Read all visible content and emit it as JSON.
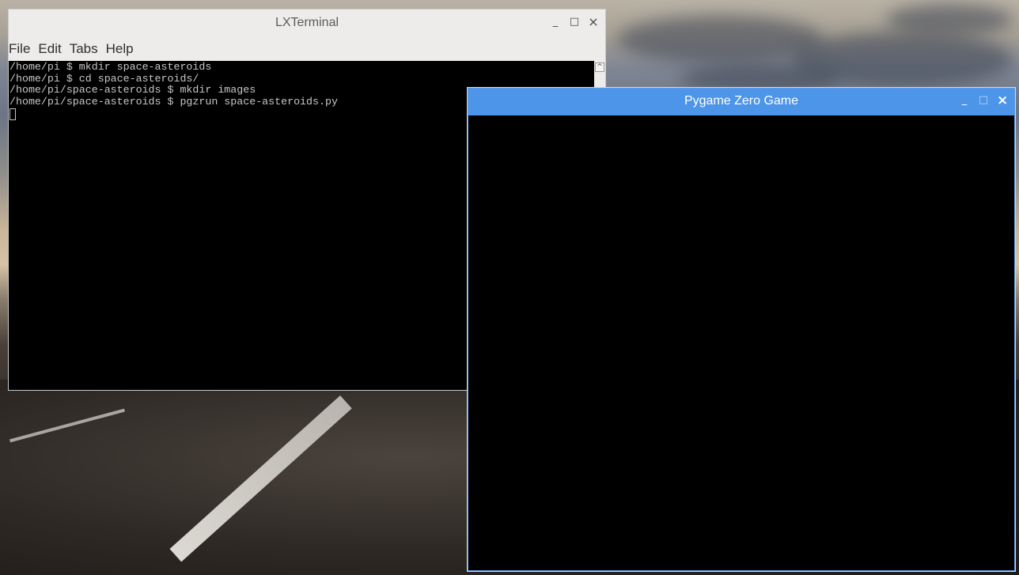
{
  "terminal": {
    "title": "LXTerminal",
    "menu": [
      "File",
      "Edit",
      "Tabs",
      "Help"
    ],
    "lines": [
      "/home/pi $ mkdir space-asteroids",
      "/home/pi $ cd space-asteroids/",
      "/home/pi/space-asteroids $ mkdir images",
      "/home/pi/space-asteroids $ pgzrun space-asteroids.py"
    ],
    "controls": {
      "minimize": "_",
      "maximize": "□",
      "close": "×"
    },
    "scroll_up_glyph": "^"
  },
  "game_window": {
    "title": "Pygame Zero Game",
    "controls": {
      "minimize": "_",
      "maximize": "□",
      "close": "×"
    },
    "background_color": "#000000"
  },
  "colors": {
    "terminal_bg": "#000000",
    "terminal_fg": "#c7c7c7",
    "game_titlebar": "#4d95e8"
  }
}
